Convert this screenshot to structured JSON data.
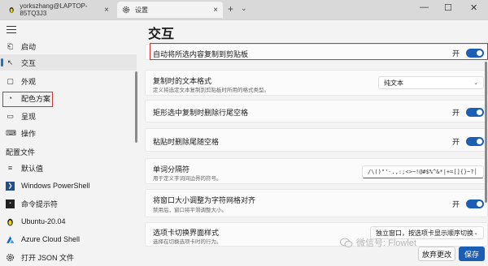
{
  "tabs": [
    {
      "title": "yorkszhang@LAPTOP-85TQ3J3"
    },
    {
      "title": "设置"
    }
  ],
  "window_controls": {
    "min": "—",
    "max": "☐",
    "close": "✕"
  },
  "sidebar": {
    "items": [
      {
        "label": "启动",
        "icon": "rocket-icon",
        "glyph": "⎗"
      },
      {
        "label": "交互",
        "icon": "cursor-icon",
        "glyph": "↖"
      },
      {
        "label": "外观",
        "icon": "appearance-icon",
        "glyph": "▢"
      },
      {
        "label": "配色方案",
        "icon": "palette-icon",
        "glyph": "◔"
      },
      {
        "label": "呈现",
        "icon": "display-icon",
        "glyph": "▭"
      },
      {
        "label": "操作",
        "icon": "keyboard-icon",
        "glyph": "⌨"
      }
    ],
    "profiles_header": "配置文件",
    "profiles": [
      {
        "label": "默认值",
        "icon": "layers-icon",
        "glyph": "≡"
      },
      {
        "label": "Windows PowerShell",
        "icon": "powershell-icon",
        "glyph": "❯"
      },
      {
        "label": "命令提示符",
        "icon": "cmd-icon",
        "glyph": "▪"
      },
      {
        "label": "Ubuntu-20.04",
        "icon": "linux-icon",
        "glyph": "◆"
      },
      {
        "label": "Azure Cloud Shell",
        "icon": "azure-icon",
        "glyph": "▲"
      }
    ],
    "open_json": "打开 JSON 文件"
  },
  "page": {
    "title": "交互",
    "settings": [
      {
        "title": "自动将所选内容复制到剪贴板",
        "toggle": "开"
      },
      {
        "title": "复制时的文本格式",
        "desc": "定义将选定文本复制到剪贴板时所用的格式类型。",
        "select": "纯文本"
      },
      {
        "title": "矩形选中复制时删除行尾空格",
        "toggle": "开"
      },
      {
        "title": "粘贴时删除尾随空格",
        "toggle": "开"
      },
      {
        "title": "单词分隔符",
        "desc": "用于定义字词间边界的符号。",
        "value": "/\\()\"'-.,:;<>~!@#$%^&*|+=[]{}~?│"
      },
      {
        "title": "将窗口大小调整为字符网格对齐",
        "desc": "禁用后，窗口将平滑调整大小。",
        "toggle": "开"
      },
      {
        "title": "选项卡切换界面样式",
        "desc": "选择在切换选项卡时的行为。",
        "select": "独立窗口，按选项卡显示顺序切换"
      }
    ]
  },
  "buttons": {
    "discard": "放弃更改",
    "save": "保存"
  },
  "watermark": "微信号: Flowlet",
  "colors": {
    "accent": "#1a5fb4",
    "highlight": "#d32f2f"
  }
}
